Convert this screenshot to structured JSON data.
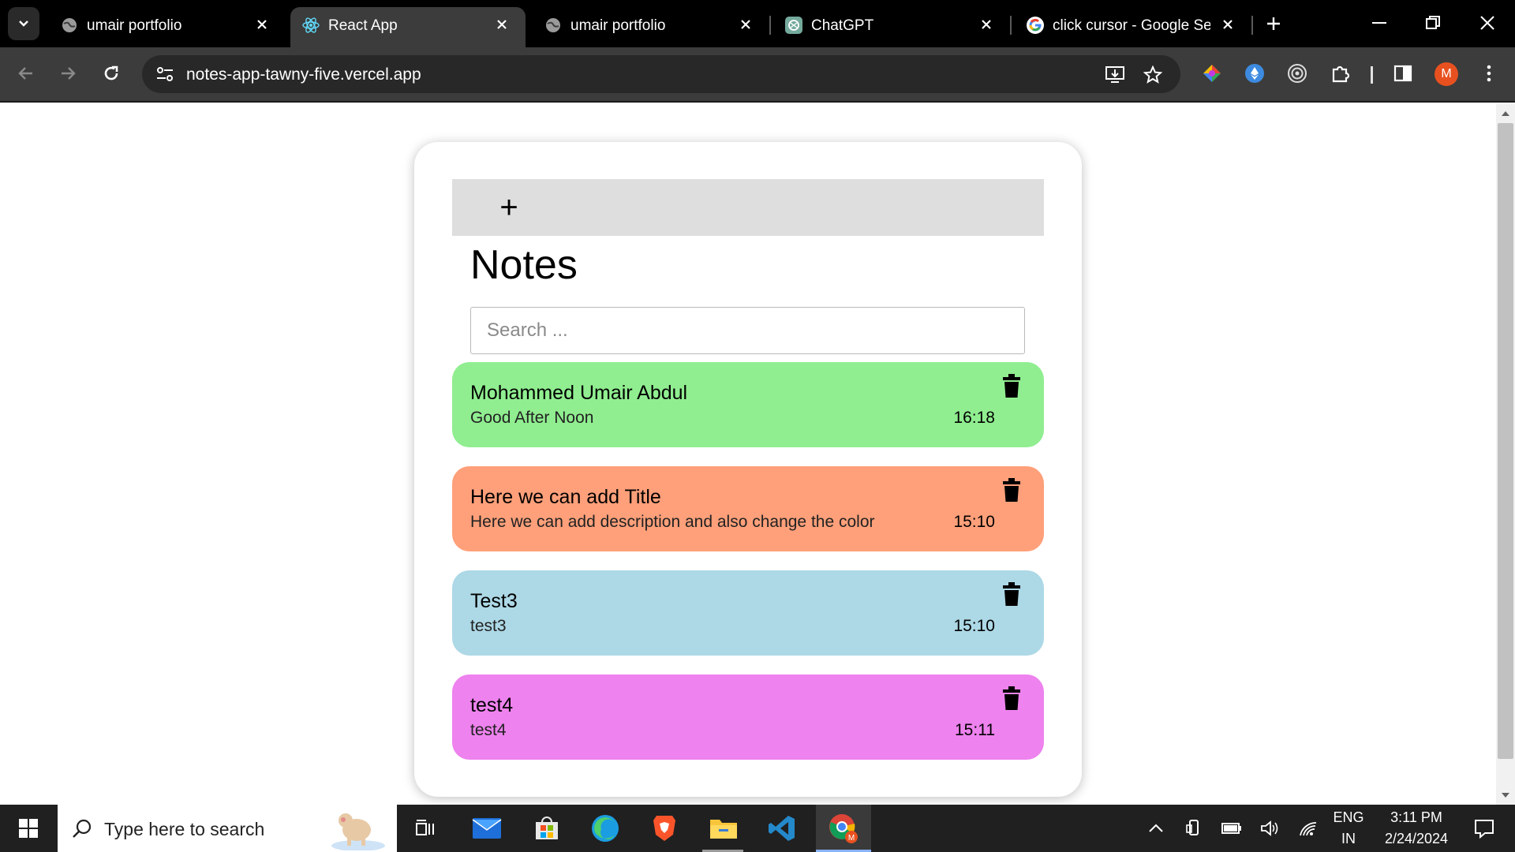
{
  "browser": {
    "tabs": [
      {
        "title": "umair portfolio",
        "icon": "globe-icon",
        "active": false
      },
      {
        "title": "React App",
        "icon": "react-icon",
        "active": true
      },
      {
        "title": "umair portfolio",
        "icon": "globe-icon",
        "active": false
      },
      {
        "title": "ChatGPT",
        "icon": "chatgpt-icon",
        "active": false
      },
      {
        "title": "click cursor - Google Sear",
        "icon": "google-icon",
        "active": false
      }
    ],
    "url": "notes-app-tawny-five.vercel.app",
    "profile_initial": "M"
  },
  "app": {
    "add_symbol": "+",
    "title": "Notes",
    "search_placeholder": "Search ...",
    "notes": [
      {
        "title": "Mohammed Umair Abdul",
        "description": "Good After Noon",
        "time": "16:18",
        "color": "#90ee90"
      },
      {
        "title": "Here we can add Title",
        "description": "Here we can add description and also change the color",
        "time": "15:10",
        "color": "#ffa07a"
      },
      {
        "title": "Test3",
        "description": "test3",
        "time": "15:10",
        "color": "#add8e6"
      },
      {
        "title": "test4",
        "description": "test4",
        "time": "15:11",
        "color": "#ee82ee"
      }
    ]
  },
  "taskbar": {
    "search_placeholder": "Type here to search",
    "language": "ENG",
    "region": "IN",
    "time": "3:11 PM",
    "date": "2/24/2024"
  }
}
